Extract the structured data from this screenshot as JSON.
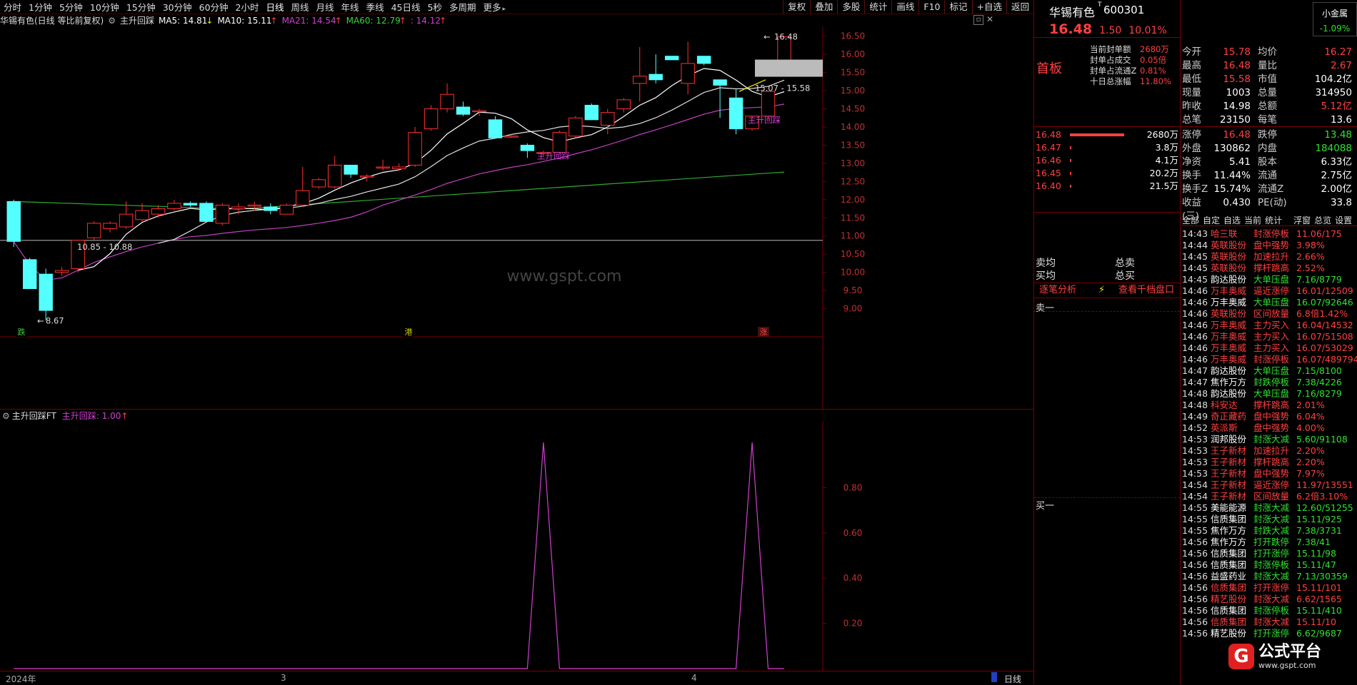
{
  "toolbar": {
    "periods": [
      "分时",
      "1分钟",
      "5分钟",
      "10分钟",
      "15分钟",
      "30分钟",
      "60分钟",
      "2小时",
      "日线",
      "周线",
      "月线",
      "年线",
      "季线",
      "45日线",
      "5秒",
      "多周期",
      "更多"
    ],
    "active_period": "日线",
    "right_buttons": [
      "复权",
      "叠加",
      "多股",
      "统计",
      "画线",
      "F10",
      "标记",
      "+自选",
      "返回"
    ]
  },
  "indicator_bar": {
    "stock_label": "华锡有色(日线 等比前复权)",
    "formula_name": "主升回踩",
    "ma5": "MA5: 14.81",
    "ma10": "MA10: 15.11",
    "ma21": "MA21: 14.54",
    "ma60": "MA60: 12.79",
    "extra": ": 14.12"
  },
  "main_chart": {
    "y_ticks": [
      "16.50",
      "16.00",
      "15.50",
      "15.00",
      "14.50",
      "14.00",
      "13.50",
      "13.00",
      "12.50",
      "12.00",
      "11.50",
      "11.00",
      "10.50",
      "10.00",
      "9.50",
      "9.00"
    ],
    "annotations": {
      "high_label": "16.48",
      "low_label": "8.67",
      "range1": "10.85 - 10.88",
      "range2": "15.07 - 15.58",
      "signal1": "主升回踩",
      "signal2": "主升回踩"
    },
    "watermark": "www.gspt.com",
    "bottom_markers": [
      "跌",
      "港",
      "涨"
    ]
  },
  "chart_data": {
    "type": "candlestick",
    "candles": [
      {
        "o": 11.95,
        "h": 12.0,
        "l": 10.7,
        "c": 10.85
      },
      {
        "o": 10.35,
        "h": 10.4,
        "l": 9.55,
        "c": 9.55
      },
      {
        "o": 9.95,
        "h": 10.1,
        "l": 8.67,
        "c": 8.95
      },
      {
        "o": 10.0,
        "h": 10.15,
        "l": 9.9,
        "c": 10.05
      },
      {
        "o": 10.1,
        "h": 10.9,
        "l": 10.0,
        "c": 10.88
      },
      {
        "o": 10.95,
        "h": 11.4,
        "l": 10.9,
        "c": 11.35
      },
      {
        "o": 11.2,
        "h": 11.4,
        "l": 11.1,
        "c": 11.35
      },
      {
        "o": 11.25,
        "h": 11.95,
        "l": 11.2,
        "c": 11.6
      },
      {
        "o": 11.45,
        "h": 11.9,
        "l": 11.4,
        "c": 11.7
      },
      {
        "o": 11.6,
        "h": 11.85,
        "l": 11.5,
        "c": 11.75
      },
      {
        "o": 11.75,
        "h": 12.0,
        "l": 11.7,
        "c": 11.9
      },
      {
        "o": 11.9,
        "h": 11.95,
        "l": 11.8,
        "c": 11.85
      },
      {
        "o": 11.9,
        "h": 11.95,
        "l": 11.4,
        "c": 11.4
      },
      {
        "o": 11.35,
        "h": 11.9,
        "l": 11.3,
        "c": 11.85
      },
      {
        "o": 11.75,
        "h": 11.9,
        "l": 11.6,
        "c": 11.8
      },
      {
        "o": 11.85,
        "h": 11.95,
        "l": 11.7,
        "c": 11.85
      },
      {
        "o": 11.8,
        "h": 11.9,
        "l": 11.6,
        "c": 11.7
      },
      {
        "o": 11.6,
        "h": 11.9,
        "l": 11.6,
        "c": 11.85
      },
      {
        "o": 11.85,
        "h": 12.9,
        "l": 11.8,
        "c": 12.25
      },
      {
        "o": 12.35,
        "h": 12.6,
        "l": 12.3,
        "c": 12.55
      },
      {
        "o": 12.35,
        "h": 13.2,
        "l": 12.3,
        "c": 12.95
      },
      {
        "o": 12.95,
        "h": 12.95,
        "l": 12.6,
        "c": 12.7
      },
      {
        "o": 12.65,
        "h": 12.7,
        "l": 12.5,
        "c": 12.65
      },
      {
        "o": 12.9,
        "h": 13.1,
        "l": 12.8,
        "c": 12.9
      },
      {
        "o": 12.85,
        "h": 13.0,
        "l": 12.8,
        "c": 12.9
      },
      {
        "o": 12.95,
        "h": 14.0,
        "l": 12.9,
        "c": 13.85
      },
      {
        "o": 13.95,
        "h": 14.6,
        "l": 13.9,
        "c": 14.5
      },
      {
        "o": 14.5,
        "h": 15.2,
        "l": 14.4,
        "c": 14.9
      },
      {
        "o": 14.55,
        "h": 14.7,
        "l": 14.3,
        "c": 14.35
      },
      {
        "o": 14.45,
        "h": 14.5,
        "l": 14.3,
        "c": 14.45
      },
      {
        "o": 14.2,
        "h": 14.3,
        "l": 13.7,
        "c": 13.7
      },
      {
        "o": 13.75,
        "h": 13.8,
        "l": 13.7,
        "c": 13.75
      },
      {
        "o": 13.5,
        "h": 13.55,
        "l": 13.15,
        "c": 13.35
      },
      {
        "o": 13.3,
        "h": 13.35,
        "l": 13.2,
        "c": 13.3
      },
      {
        "o": 13.3,
        "h": 13.9,
        "l": 13.25,
        "c": 13.85
      },
      {
        "o": 13.75,
        "h": 14.3,
        "l": 13.7,
        "c": 14.25
      },
      {
        "o": 14.6,
        "h": 14.65,
        "l": 14.2,
        "c": 14.2
      },
      {
        "o": 14.05,
        "h": 14.5,
        "l": 13.8,
        "c": 14.4
      },
      {
        "o": 14.5,
        "h": 14.8,
        "l": 14.4,
        "c": 14.75
      },
      {
        "o": 15.2,
        "h": 16.2,
        "l": 14.7,
        "c": 15.4
      },
      {
        "o": 15.45,
        "h": 16.0,
        "l": 15.2,
        "c": 15.3
      },
      {
        "o": 15.95,
        "h": 15.95,
        "l": 15.85,
        "c": 15.85
      },
      {
        "o": 15.2,
        "h": 16.35,
        "l": 14.9,
        "c": 15.75
      },
      {
        "o": 15.95,
        "h": 15.95,
        "l": 15.7,
        "c": 15.75
      },
      {
        "o": 15.3,
        "h": 15.3,
        "l": 14.25,
        "c": 15.15
      },
      {
        "o": 14.8,
        "h": 15.05,
        "l": 13.8,
        "c": 13.95
      },
      {
        "o": 13.95,
        "h": 14.3,
        "l": 13.9,
        "c": 14.3
      },
      {
        "o": 14.3,
        "h": 15.0,
        "l": 14.2,
        "c": 14.98
      },
      {
        "o": 15.78,
        "h": 16.5,
        "l": 15.58,
        "c": 16.48
      }
    ],
    "sub_series": {
      "name": "主升回踩",
      "value_label": "主升回踩: 1.00",
      "signals_at": [
        33,
        46
      ]
    },
    "sub_y_ticks": [
      "0.80",
      "0.60",
      "0.40",
      "0.20"
    ],
    "x_labels": [
      "2024年",
      "3",
      "4"
    ]
  },
  "sub_chart": {
    "title": "主升回踩FT",
    "label": "主升回踩: 1.00"
  },
  "status": {
    "period": "日线"
  },
  "quote": {
    "name": "华锡有色",
    "code": "600301",
    "tag": "小金属",
    "tag_change": "-1.09%",
    "price": "16.48",
    "change": "1.50",
    "pct": "10.01%",
    "board_label": "首板",
    "seal_info": [
      {
        "k": "当前封单额",
        "v": "2680万"
      },
      {
        "k": "封单占成交",
        "v": "0.05倍"
      },
      {
        "k": "封单占流通Z",
        "v": "0.81%"
      },
      {
        "k": "十日总涨幅",
        "v": "11.80%"
      }
    ],
    "stats": [
      {
        "k1": "今开",
        "v1": "15.78",
        "k2": "均价",
        "v2": "16.27"
      },
      {
        "k1": "最高",
        "v1": "16.48",
        "k2": "量比",
        "v2": "2.67"
      },
      {
        "k1": "最低",
        "v1": "15.58",
        "k2": "市值",
        "v2": "104.2亿"
      },
      {
        "k1": "现量",
        "v1": "1003",
        "k2": "总量",
        "v2": "314950"
      },
      {
        "k1": "昨收",
        "v1": "14.98",
        "k2": "总额",
        "v2": "5.12亿"
      },
      {
        "k1": "总笔",
        "v1": "23150",
        "k2": "每笔",
        "v2": "13.6"
      }
    ],
    "stats2": [
      {
        "k1": "涨停",
        "v1": "16.48",
        "k2": "跌停",
        "v2": "13.48"
      },
      {
        "k1": "外盘",
        "v1": "130862",
        "k2": "内盘",
        "v2": "184088"
      },
      {
        "k1": "净资",
        "v1": "5.41",
        "k2": "股本",
        "v2": "6.33亿"
      },
      {
        "k1": "换手",
        "v1": "11.44%",
        "k2": "流通",
        "v2": "2.75亿"
      },
      {
        "k1": "换手Z",
        "v1": "15.74%",
        "k2": "流通Z",
        "v2": "2.00亿"
      },
      {
        "k1": "收益(三)",
        "v1": "0.430",
        "k2": "PE(动)",
        "v2": "33.8"
      }
    ],
    "book": [
      {
        "p": "16.48",
        "v": "2680万",
        "bar": 95
      },
      {
        "p": "16.47",
        "v": "3.8万",
        "bar": 2
      },
      {
        "p": "16.46",
        "v": "4.1万",
        "bar": 2
      },
      {
        "p": "16.45",
        "v": "20.2万",
        "bar": 2
      },
      {
        "p": "16.40",
        "v": "21.5万",
        "bar": 2
      }
    ],
    "sell_avg": "卖均",
    "buy_avg": "买均",
    "total_sell": "总卖",
    "total_buy": "总买",
    "detail_btn": "逐笔分析",
    "thousand_btn": "查看千档盘口",
    "sell1": "卖一",
    "buy1": "买一"
  },
  "tape_tabs": [
    "全部",
    "自定",
    "自选",
    "当前",
    "统计",
    "浮窗",
    "总览",
    "设置"
  ],
  "tape": [
    {
      "t": "14:43",
      "n": "哈三联",
      "e": "封涨停板",
      "v": "11.06/175",
      "c": "r"
    },
    {
      "t": "14:44",
      "n": "英联股份",
      "e": "盘中强势",
      "v": "3.98%",
      "c": "r"
    },
    {
      "t": "14:45",
      "n": "英联股份",
      "e": "加速拉升",
      "v": "2.66%",
      "c": "r"
    },
    {
      "t": "14:45",
      "n": "英联股份",
      "e": "撑杆跳高",
      "v": "2.52%",
      "c": "r"
    },
    {
      "t": "14:45",
      "n": "韵达股份",
      "e": "大单压盘",
      "v": "7.16/8779",
      "c": "g"
    },
    {
      "t": "14:46",
      "n": "万丰奥威",
      "e": "逼近涨停",
      "v": "16.01/12509",
      "c": "r"
    },
    {
      "t": "14:46",
      "n": "万丰奥威",
      "e": "大单压盘",
      "v": "16.07/92646",
      "c": "g"
    },
    {
      "t": "14:46",
      "n": "英联股份",
      "e": "区间放量",
      "v": "6.8倍1.42%",
      "c": "r"
    },
    {
      "t": "14:46",
      "n": "万丰奥威",
      "e": "主力买入",
      "v": "16.04/14532",
      "c": "r"
    },
    {
      "t": "14:46",
      "n": "万丰奥威",
      "e": "主力买入",
      "v": "16.07/51508",
      "c": "r"
    },
    {
      "t": "14:46",
      "n": "万丰奥威",
      "e": "主力买入",
      "v": "16.07/53029",
      "c": "r"
    },
    {
      "t": "14:46",
      "n": "万丰奥威",
      "e": "封涨停板",
      "v": "16.07/489794",
      "c": "r"
    },
    {
      "t": "14:47",
      "n": "韵达股份",
      "e": "大单压盘",
      "v": "7.15/8100",
      "c": "g"
    },
    {
      "t": "14:47",
      "n": "焦作万方",
      "e": "封跌停板",
      "v": "7.38/4226",
      "c": "g"
    },
    {
      "t": "14:48",
      "n": "韵达股份",
      "e": "大单压盘",
      "v": "7.16/8279",
      "c": "g"
    },
    {
      "t": "14:48",
      "n": "科安达",
      "e": "撑杆跳高",
      "v": "2.01%",
      "c": "r"
    },
    {
      "t": "14:49",
      "n": "奇正藏药",
      "e": "盘中强势",
      "v": "6.04%",
      "c": "r"
    },
    {
      "t": "14:52",
      "n": "英派斯",
      "e": "盘中强势",
      "v": "4.00%",
      "c": "r"
    },
    {
      "t": "14:53",
      "n": "润邦股份",
      "e": "封涨大减",
      "v": "5.60/91108",
      "c": "g"
    },
    {
      "t": "14:53",
      "n": "王子新材",
      "e": "加速拉升",
      "v": "2.20%",
      "c": "r"
    },
    {
      "t": "14:53",
      "n": "王子新材",
      "e": "撑杆跳高",
      "v": "2.20%",
      "c": "r"
    },
    {
      "t": "14:53",
      "n": "王子新材",
      "e": "盘中强势",
      "v": "7.97%",
      "c": "r"
    },
    {
      "t": "14:54",
      "n": "王子新材",
      "e": "逼近涨停",
      "v": "11.97/13551",
      "c": "r"
    },
    {
      "t": "14:54",
      "n": "王子新材",
      "e": "区间放量",
      "v": "6.2倍3.10%",
      "c": "r"
    },
    {
      "t": "14:55",
      "n": "美能能源",
      "e": "封涨大减",
      "v": "12.60/51255",
      "c": "g"
    },
    {
      "t": "14:55",
      "n": "信质集团",
      "e": "封涨大减",
      "v": "15.11/925",
      "c": "g"
    },
    {
      "t": "14:55",
      "n": "焦作万方",
      "e": "封跌大减",
      "v": "7.38/3731",
      "c": "g"
    },
    {
      "t": "14:56",
      "n": "焦作万方",
      "e": "打开跌停",
      "v": "7.38/41",
      "c": "g"
    },
    {
      "t": "14:56",
      "n": "信质集团",
      "e": "打开涨停",
      "v": "15.11/98",
      "c": "g"
    },
    {
      "t": "14:56",
      "n": "信质集团",
      "e": "封涨停板",
      "v": "15.11/47",
      "c": "g"
    },
    {
      "t": "14:56",
      "n": "益盛药业",
      "e": "封涨大减",
      "v": "7.13/30359",
      "c": "g"
    },
    {
      "t": "14:56",
      "n": "信质集团",
      "e": "打开涨停",
      "v": "15.11/101",
      "c": "r"
    },
    {
      "t": "14:56",
      "n": "精艺股份",
      "e": "封涨大减",
      "v": "6.62/1565",
      "c": "r"
    },
    {
      "t": "14:56",
      "n": "信质集团",
      "e": "封涨停板",
      "v": "15.11/410",
      "c": "g"
    },
    {
      "t": "14:56",
      "n": "信质集团",
      "e": "封涨大减",
      "v": "15.11/10",
      "c": "r"
    },
    {
      "t": "14:56",
      "n": "精艺股份",
      "e": "打开涨停",
      "v": "6.62/9687",
      "c": "g"
    }
  ],
  "brand": {
    "name": "公式平台",
    "url": "www.gspt.com"
  }
}
